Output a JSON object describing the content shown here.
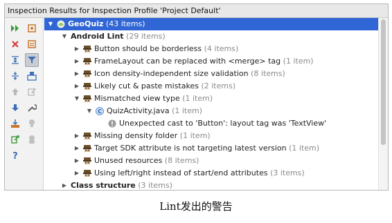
{
  "panel": {
    "title": "Inspection Results for Inspection Profile 'Project Default'"
  },
  "toolbar": {
    "buttons": [
      {
        "icon": "run-icon",
        "color": "#3a9a3a"
      },
      {
        "icon": "settings-file-icon",
        "color": "#c8752a"
      },
      {
        "icon": "close-icon",
        "color": "#d33a3a"
      },
      {
        "icon": "file-icon",
        "color": "#c8752a"
      },
      {
        "icon": "expand-all-icon",
        "color": "#3c6fb4"
      },
      {
        "icon": "filter-icon",
        "color": "#3c6fb4"
      },
      {
        "icon": "collapse-all-icon",
        "color": "#3c6fb4"
      },
      {
        "icon": "group-by-icon",
        "color": "#3c6fb4"
      },
      {
        "icon": "up-arrow-icon",
        "color": "#b8b8b8"
      },
      {
        "icon": "edit-icon",
        "color": "#b8b8b8"
      },
      {
        "icon": "down-arrow-icon",
        "color": "#3c6fb4"
      },
      {
        "icon": "wrench-icon",
        "color": "#666666"
      },
      {
        "icon": "export-icon",
        "color": "#c8752a"
      },
      {
        "icon": "lightbulb-icon",
        "color": "#c0c0c0"
      },
      {
        "icon": "share-icon",
        "color": "#3a9a3a"
      },
      {
        "icon": "disabled-icon",
        "color": "#c0c0c0"
      },
      {
        "icon": "help-icon",
        "color": "#3c6fb4"
      }
    ]
  },
  "tree": {
    "rows": [
      {
        "label": "GeoQuiz",
        "count": "(43 items)",
        "arrow": "expanded",
        "icon": "android-module-icon",
        "bold": true,
        "selected": true
      },
      {
        "label": "Android Lint",
        "count": "(29 items)",
        "arrow": "expanded",
        "icon": "",
        "bold": true
      },
      {
        "label": "Button should be borderless",
        "count": "(4 items)",
        "arrow": "collapsed",
        "icon": "inspection-icon"
      },
      {
        "label": "FrameLayout can be replaced with <merge> tag",
        "count": "(1 item)",
        "arrow": "collapsed",
        "icon": "inspection-icon"
      },
      {
        "label": "Icon density-independent size validation",
        "count": "(8 items)",
        "arrow": "collapsed",
        "icon": "inspection-icon"
      },
      {
        "label": "Likely cut & paste mistakes",
        "count": "(2 items)",
        "arrow": "collapsed",
        "icon": "inspection-icon"
      },
      {
        "label": "Mismatched view type",
        "count": "(1 item)",
        "arrow": "expanded",
        "icon": "inspection-icon"
      },
      {
        "label": "QuizActivity.java",
        "count": "(1 item)",
        "arrow": "expanded",
        "icon": "java-class-icon"
      },
      {
        "label": "Unexpected cast to 'Button': layout tag was 'TextView'",
        "count": "",
        "arrow": "none",
        "icon": "warning-icon"
      },
      {
        "label": "Missing density folder",
        "count": "(1 item)",
        "arrow": "collapsed",
        "icon": "inspection-icon"
      },
      {
        "label": "Target SDK attribute is not targeting latest version",
        "count": "(1 item)",
        "arrow": "collapsed",
        "icon": "inspection-icon"
      },
      {
        "label": "Unused resources",
        "count": "(8 items)",
        "arrow": "collapsed",
        "icon": "inspection-icon"
      },
      {
        "label": "Using left/right instead of start/end attributes",
        "count": "(3 items)",
        "arrow": "collapsed",
        "icon": "inspection-icon"
      },
      {
        "label": "Class structure",
        "count": "(3 items)",
        "arrow": "collapsed",
        "icon": "",
        "bold": true
      }
    ]
  },
  "colors": {
    "selection": "#2f65d4",
    "count_text": "#8a8a8a"
  },
  "caption": "Lint发出的警告"
}
